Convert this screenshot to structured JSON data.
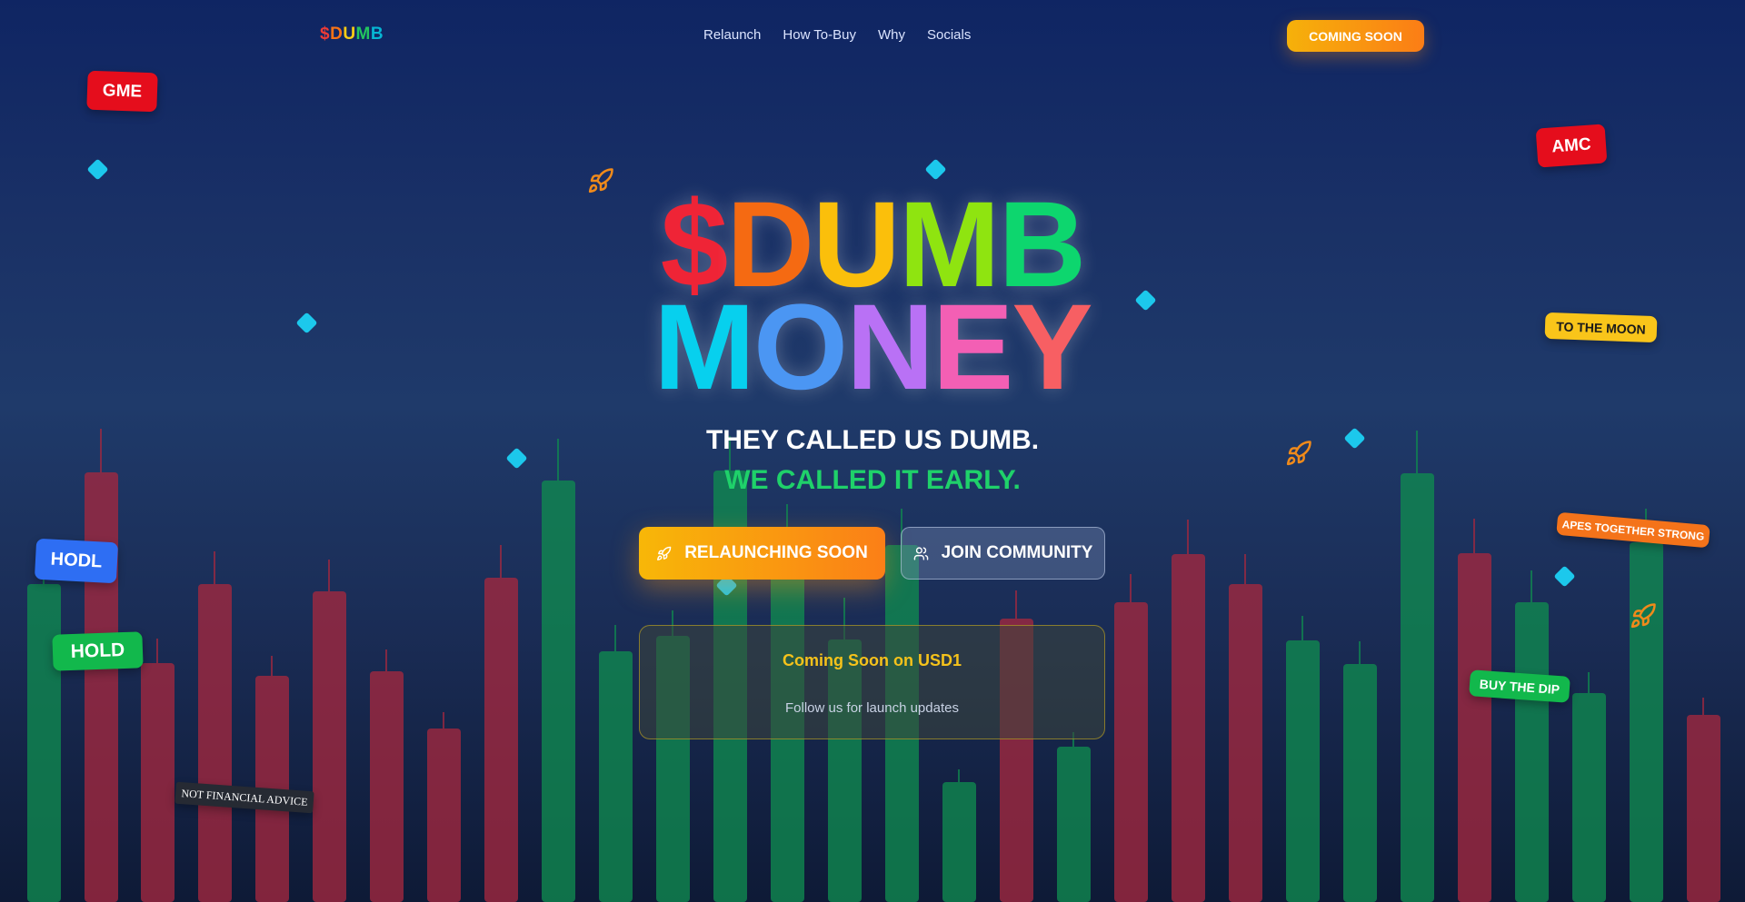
{
  "nav": {
    "logo": [
      "$",
      "D",
      "U",
      "M",
      "B"
    ],
    "logo_colors": [
      "#ef3b36",
      "#f97316",
      "#facc15",
      "#22c55e",
      "#06b6d4"
    ],
    "links": [
      "Relaunch",
      "How To-Buy",
      "Why",
      "Socials"
    ],
    "cta": "COMING SOON"
  },
  "hero": {
    "line1": [
      "$",
      "D",
      "U",
      "M",
      "B"
    ],
    "line1_colors": [
      "#ef2436",
      "#f56a12",
      "#fbbf0b",
      "#8fe410",
      "#0dd66e"
    ],
    "line2": [
      "M",
      "O",
      "N",
      "E",
      "Y"
    ],
    "line2_colors": [
      "#07d0ee",
      "#4b96f3",
      "#b971f5",
      "#f35fb4",
      "#f75f63"
    ],
    "tagline1": "THEY CALLED US DUMB.",
    "tagline2": "WE CALLED IT EARLY."
  },
  "buttons": {
    "primary": "RELAUNCHING SOON",
    "secondary": "JOIN COMMUNITY"
  },
  "info": {
    "title": "Coming Soon on USD1",
    "subtitle": "Follow us for launch updates"
  },
  "stickers": {
    "gme": "GME",
    "amc": "AMC",
    "to_the_moon": "TO THE MOON",
    "hodl": "HODL",
    "hold": "HOLD",
    "apes": "APES TOGETHER STRONG",
    "buy_dip": "BUY THE DIP",
    "nfa": "NOT FINANCIAL ADVICE"
  },
  "colors": {
    "candle_red": "#a3283f",
    "candle_green": "#0f8a4f",
    "accent_orange": "#f8a50e",
    "diamond": "#1cc8ec"
  }
}
